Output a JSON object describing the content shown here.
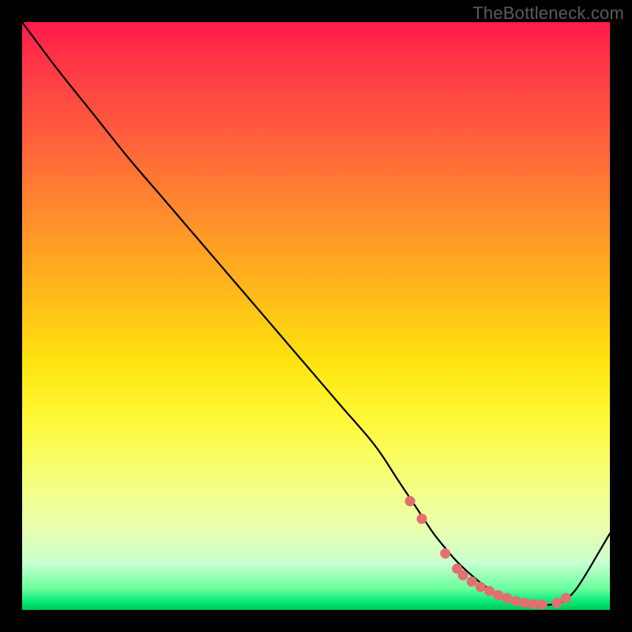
{
  "watermark": "TheBottleneck.com",
  "colors": {
    "background": "#000000",
    "curve_stroke": "#000000",
    "marker_fill": "#e27070",
    "marker_stroke": "#c05a5a",
    "watermark_text": "#5b5b5b"
  },
  "chart_data": {
    "type": "line",
    "title": "",
    "xlabel": "",
    "ylabel": "",
    "xlim": [
      0,
      100
    ],
    "ylim": [
      0,
      100
    ],
    "grid": false,
    "legend": false,
    "series": [
      {
        "name": "bottleneck-curve",
        "x": [
          0,
          6,
          12,
          18,
          24,
          30,
          36,
          42,
          48,
          54,
          60,
          64,
          68,
          70,
          72,
          74,
          76,
          78,
          80,
          82,
          84,
          86,
          88,
          90,
          92,
          94,
          96,
          98,
          100
        ],
        "y": [
          100,
          92,
          84.5,
          77,
          70,
          63,
          56,
          49,
          42,
          35,
          28,
          22,
          16,
          13,
          10.5,
          8.2,
          6.3,
          4.6,
          3.2,
          2.2,
          1.4,
          1.0,
          0.8,
          0.9,
          1.4,
          3.2,
          6.2,
          9.6,
          13.0
        ]
      }
    ],
    "markers": {
      "name": "highlight-points",
      "x": [
        66,
        68,
        72,
        74,
        75,
        76.5,
        78,
        79.5,
        81,
        82.5,
        84,
        85.5,
        87,
        88.5,
        91,
        92.5
      ],
      "y": [
        18.5,
        15.5,
        9.6,
        7.0,
        5.9,
        4.8,
        3.9,
        3.2,
        2.5,
        2.0,
        1.5,
        1.2,
        1.0,
        0.9,
        1.2,
        2.0
      ]
    }
  }
}
